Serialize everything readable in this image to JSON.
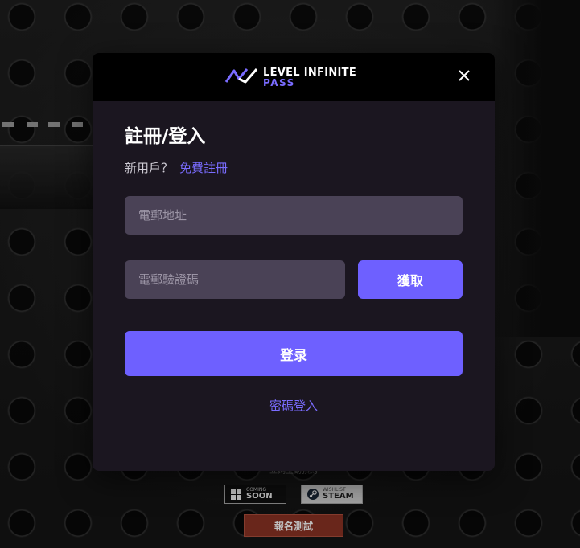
{
  "background": {
    "caption": "立刻主動預約",
    "badges": [
      {
        "small": "COMING",
        "big": "SOON",
        "icon": "windows-icon"
      },
      {
        "small": "WISHLIST",
        "big": "STEAM",
        "icon": "steam-icon"
      }
    ],
    "signup_label": "報名測試"
  },
  "modal": {
    "logo": {
      "line1": "LEVEL INFINITE",
      "line2": "PASS",
      "icon": "level-infinite-logo-icon"
    },
    "close_icon": "close-icon",
    "title": "註冊/登入",
    "new_user_prompt": "新用戶？",
    "register_link": "免費註冊",
    "email": {
      "placeholder": "電郵地址",
      "value": ""
    },
    "code": {
      "placeholder": "電郵驗證碼",
      "value": ""
    },
    "get_code_label": "獲取",
    "login_label": "登录",
    "password_login_link": "密碼登入"
  },
  "colors": {
    "accent": "#6e60ff",
    "modal_bg": "#1b1620",
    "input_bg": "#4a4256",
    "signup_red": "#8c3324"
  }
}
